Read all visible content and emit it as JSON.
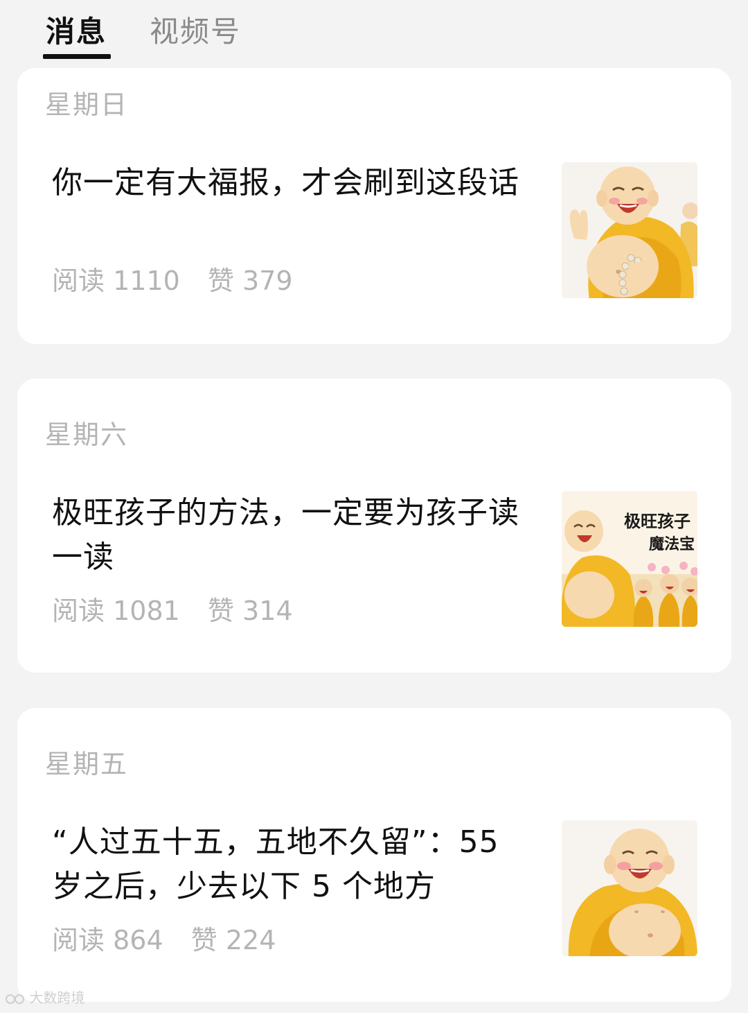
{
  "tabs": {
    "messages": "消息",
    "channels": "视频号"
  },
  "articles": [
    {
      "day": "星期日",
      "title": "你一定有大福报，才会刷到这段话",
      "read_label": "阅读",
      "read_count": "1110",
      "like_label": "赞",
      "like_count": "379",
      "thumbnail": "laughing-buddha-icon"
    },
    {
      "day": "星期六",
      "title": "极旺孩子的方法，一定要为孩子读一读",
      "read_label": "阅读",
      "read_count": "1081",
      "like_label": "赞",
      "like_count": "314",
      "thumbnail": "laughing-buddha-children-icon",
      "thumbnail_text_1": "极旺孩子",
      "thumbnail_text_2": "魔法宝"
    },
    {
      "day": "星期五",
      "title": "“人过五十五，五地不久留”：55 岁之后，少去以下 5 个地方",
      "read_label": "阅读",
      "read_count": "864",
      "like_label": "赞",
      "like_count": "224",
      "thumbnail": "laughing-buddha-icon"
    }
  ],
  "watermark": "大数跨境",
  "colors": {
    "background": "#f3f3f3",
    "card": "#ffffff",
    "title_text": "#111111",
    "muted_text": "#b4b4b4",
    "robe": "#f2b825",
    "skin": "#f7d9b0"
  }
}
